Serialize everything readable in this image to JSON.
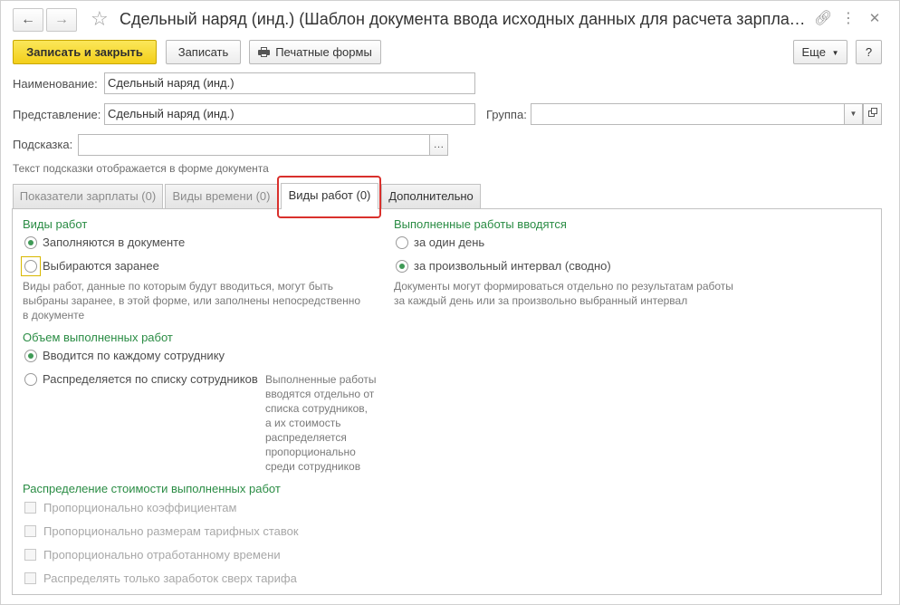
{
  "window": {
    "title": "Сдельный наряд (инд.) (Шаблон документа ввода исходных данных для расчета зарплаты)"
  },
  "toolbar": {
    "write_close": "Записать и закрыть",
    "write": "Записать",
    "print_forms": "Печатные формы",
    "more": "Еще",
    "help": "?"
  },
  "fields": {
    "name_label": "Наименование:",
    "name_value": "Сдельный наряд (инд.)",
    "presentation_label": "Представление:",
    "presentation_value": "Сдельный наряд (инд.)",
    "group_label": "Группа:",
    "group_value": "",
    "hint_label": "Подсказка:",
    "hint_value": "",
    "hint_note": "Текст подсказки отображается в форме документа"
  },
  "tabs": [
    {
      "label": "Показатели зарплаты (0)"
    },
    {
      "label": "Виды времени (0)"
    },
    {
      "label": "Виды работ (0)"
    },
    {
      "label": "Дополнительно"
    }
  ],
  "active_tab": "Виды работ (0)",
  "work_types": {
    "heading": "Виды работ",
    "options": [
      {
        "label": "Заполняются в документе",
        "selected": true
      },
      {
        "label": "Выбираются заранее",
        "selected": false
      }
    ],
    "description": [
      "Виды работ, данные по которым будут вводиться, могут быть",
      "выбраны заранее, в этой форме, или заполнены непосредственно",
      "в документе"
    ]
  },
  "completed_input": {
    "heading": "Выполненные работы вводятся",
    "options": [
      {
        "label": "за один день",
        "selected": false
      },
      {
        "label": "за произвольный интервал (сводно)",
        "selected": true
      }
    ],
    "description": [
      "Документы могут формироваться отдельно по результатам работы",
      "за каждый день или за произвольно выбранный интервал"
    ]
  },
  "volume": {
    "heading": "Объем выполненных работ",
    "options": [
      {
        "label": "Вводится по каждому сотруднику",
        "selected": true
      },
      {
        "label": "Распределяется по списку сотрудников",
        "selected": false
      }
    ],
    "description": [
      "Выполненные работы",
      "вводятся отдельно от",
      "списка сотрудников,",
      "а их стоимость",
      "распределяется",
      "пропорционально",
      "среди сотрудников"
    ]
  },
  "cost_distribution": {
    "heading": "Распределение стоимости выполненных работ",
    "options": [
      {
        "label": "Пропорционально коэффициентам",
        "checked": false,
        "enabled": false
      },
      {
        "label": "Пропорционально размерам тарифных ставок",
        "checked": false,
        "enabled": false
      },
      {
        "label": "Пропорционально отработанному времени",
        "checked": false,
        "enabled": false
      },
      {
        "label": "Распределять только заработок сверх тарифа",
        "checked": false,
        "enabled": false
      }
    ]
  },
  "colors": {
    "accent_green": "#2a8c44",
    "primary_button": "#f3cf1a",
    "focus_frame": "#d9302c"
  }
}
